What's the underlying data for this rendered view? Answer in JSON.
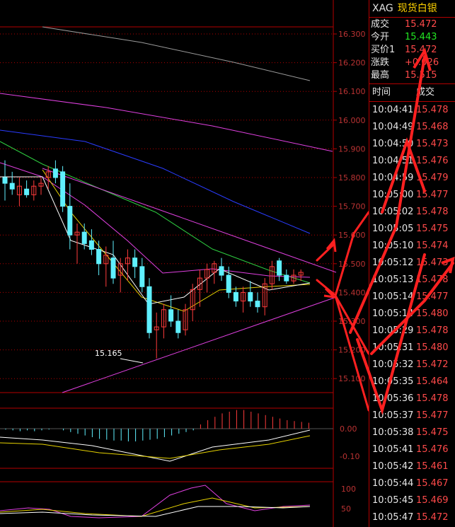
{
  "instrument": {
    "symbol": "XAG",
    "name": "现货白银"
  },
  "quote": [
    {
      "label": "成交",
      "value": "15.472",
      "color": "red"
    },
    {
      "label": "今开",
      "value": "15.443",
      "color": "green"
    },
    {
      "label": "买价1",
      "value": "15.472",
      "color": "red"
    },
    {
      "label": "涨跌",
      "value": "+0.026",
      "color": "red"
    },
    {
      "label": "最高",
      "value": "15.515",
      "color": "red"
    }
  ],
  "ticks_header": {
    "time": "时间",
    "price": "成交"
  },
  "ticks": [
    {
      "time": "10:04:41",
      "price": "15.478"
    },
    {
      "time": "10:04:49",
      "price": "15.468"
    },
    {
      "time": "10:04:50",
      "price": "15.473"
    },
    {
      "time": "10:04:51",
      "price": "15.476"
    },
    {
      "time": "10:04:59",
      "price": "15.479"
    },
    {
      "time": "10:05:00",
      "price": "15.477"
    },
    {
      "time": "10:05:02",
      "price": "15.478"
    },
    {
      "time": "10:05:05",
      "price": "15.475"
    },
    {
      "time": "10:05:10",
      "price": "15.474"
    },
    {
      "time": "10:05:12",
      "price": "15.473"
    },
    {
      "time": "10:05:13",
      "price": "15.478"
    },
    {
      "time": "10:05:14",
      "price": "15.477"
    },
    {
      "time": "10:05:14",
      "price": "15.480"
    },
    {
      "time": "10:05:29",
      "price": "15.478"
    },
    {
      "time": "10:05:31",
      "price": "15.480"
    },
    {
      "time": "10:05:32",
      "price": "15.472"
    },
    {
      "time": "10:05:35",
      "price": "15.464"
    },
    {
      "time": "10:05:36",
      "price": "15.478"
    },
    {
      "time": "10:05:37",
      "price": "15.477"
    },
    {
      "time": "10:05:38",
      "price": "15.475"
    },
    {
      "time": "10:05:41",
      "price": "15.476"
    },
    {
      "time": "10:05:42",
      "price": "15.461"
    },
    {
      "time": "10:05:44",
      "price": "15.467"
    },
    {
      "time": "10:05:45",
      "price": "15.469"
    },
    {
      "time": "10:05:47",
      "price": "15.472"
    }
  ],
  "colors": {
    "up": "#ff3b3b",
    "down": "#5ff0ff",
    "axis": "#b30000",
    "ma_gray": "#9a9a9a",
    "ma_magenta": "#e040e0",
    "ma_blue": "#2a3cff",
    "ma_green": "#2ecc40",
    "ma_yellow": "#e6d200",
    "trend": "#e040e0",
    "arrow": "#ff2020"
  },
  "chart_data": {
    "type": "candlestick",
    "price_axis": {
      "ticks": [
        "16.300",
        "16.200",
        "16.100",
        "16.000",
        "15.900",
        "15.800",
        "15.700",
        "15.600",
        "15.500",
        "15.400",
        "15.300",
        "15.200",
        "15.100"
      ],
      "ylim": [
        15.08,
        16.32
      ]
    },
    "low_annotation": "15.165",
    "candles": [
      [
        15.8,
        15.86,
        15.72,
        15.78
      ],
      [
        15.78,
        15.82,
        15.74,
        15.76
      ],
      [
        15.74,
        15.8,
        15.7,
        15.77
      ],
      [
        15.76,
        15.79,
        15.73,
        15.74
      ],
      [
        15.74,
        15.79,
        15.72,
        15.77
      ],
      [
        15.77,
        15.8,
        15.74,
        15.78
      ],
      [
        15.8,
        15.84,
        15.76,
        15.82
      ],
      [
        15.83,
        15.86,
        15.78,
        15.8
      ],
      [
        15.82,
        15.84,
        15.68,
        15.7
      ],
      [
        15.7,
        15.78,
        15.55,
        15.6
      ],
      [
        15.6,
        15.64,
        15.5,
        15.61
      ],
      [
        15.61,
        15.64,
        15.55,
        15.57
      ],
      [
        15.58,
        15.62,
        15.53,
        15.55
      ],
      [
        15.55,
        15.58,
        15.46,
        15.5
      ],
      [
        15.5,
        15.56,
        15.42,
        15.53
      ],
      [
        15.52,
        15.58,
        15.43,
        15.45
      ],
      [
        15.46,
        15.52,
        15.4,
        15.5
      ],
      [
        15.5,
        15.55,
        15.44,
        15.52
      ],
      [
        15.52,
        15.55,
        15.45,
        15.49
      ],
      [
        15.49,
        15.52,
        15.4,
        15.42
      ],
      [
        15.42,
        15.45,
        15.24,
        15.26
      ],
      [
        15.27,
        15.33,
        15.17,
        15.28
      ],
      [
        15.28,
        15.36,
        15.24,
        15.34
      ],
      [
        15.34,
        15.39,
        15.28,
        15.3
      ],
      [
        15.3,
        15.34,
        15.24,
        15.26
      ],
      [
        15.27,
        15.36,
        15.25,
        15.34
      ],
      [
        15.34,
        15.43,
        15.3,
        15.41
      ],
      [
        15.41,
        15.48,
        15.35,
        15.45
      ],
      [
        15.45,
        15.5,
        15.4,
        15.48
      ],
      [
        15.47,
        15.51,
        15.43,
        15.5
      ],
      [
        15.49,
        15.52,
        15.44,
        15.46
      ],
      [
        15.46,
        15.49,
        15.38,
        15.4
      ],
      [
        15.4,
        15.42,
        15.35,
        15.37
      ],
      [
        15.37,
        15.42,
        15.33,
        15.4
      ],
      [
        15.4,
        15.44,
        15.35,
        15.37
      ],
      [
        15.37,
        15.4,
        15.33,
        15.35
      ],
      [
        15.35,
        15.45,
        15.32,
        15.43
      ],
      [
        15.43,
        15.51,
        15.41,
        15.49
      ],
      [
        15.51,
        15.52,
        15.44,
        15.46
      ],
      [
        15.46,
        15.48,
        15.43,
        15.44
      ],
      [
        15.44,
        15.48,
        15.43,
        15.46
      ],
      [
        15.46,
        15.48,
        15.44,
        15.47
      ]
    ],
    "macd_axis": [
      "0.00",
      "-0.10"
    ],
    "kdj_axis": [
      "100",
      "50"
    ]
  }
}
